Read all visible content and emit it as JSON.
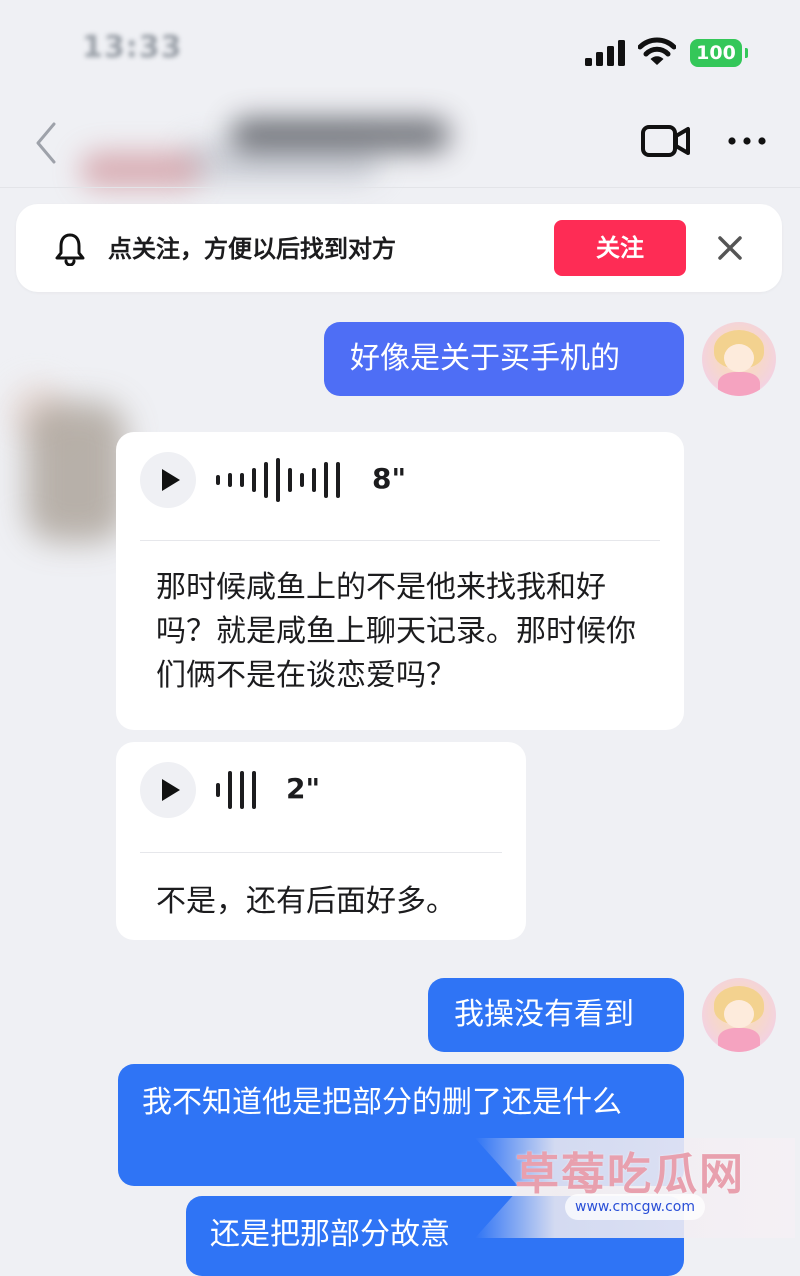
{
  "status_bar": {
    "time": "13:33",
    "battery": "100"
  },
  "banner": {
    "text": "点关注，方便以后找到对方",
    "follow_label": "关注"
  },
  "messages": {
    "m1": "好像是关于买手机的",
    "v1": {
      "duration": "8\"",
      "transcript": "那时候咸鱼上的不是他来找我和好吗？就是咸鱼上聊天记录。那时候你们俩不是在谈恋爱吗？"
    },
    "v2": {
      "duration": "2\"",
      "transcript": "不是，还有后面好多。"
    },
    "m2": "我操没有看到",
    "m3": "我不知道他是把部分的删了还是什么",
    "m4": "还是把那部分故意"
  },
  "watermark": {
    "title": "草莓吃瓜网",
    "url": "www.cmcgw.com"
  },
  "icons": [
    "signal-icon",
    "wifi-icon",
    "back-icon",
    "video-call-icon",
    "more-icon",
    "bell-icon",
    "close-icon",
    "play-icon"
  ],
  "colors": {
    "follow": "#fe2c55",
    "bubble_me": "#4e6ef5",
    "bubble_blue": "#2f74f5",
    "battery": "#34c759"
  }
}
